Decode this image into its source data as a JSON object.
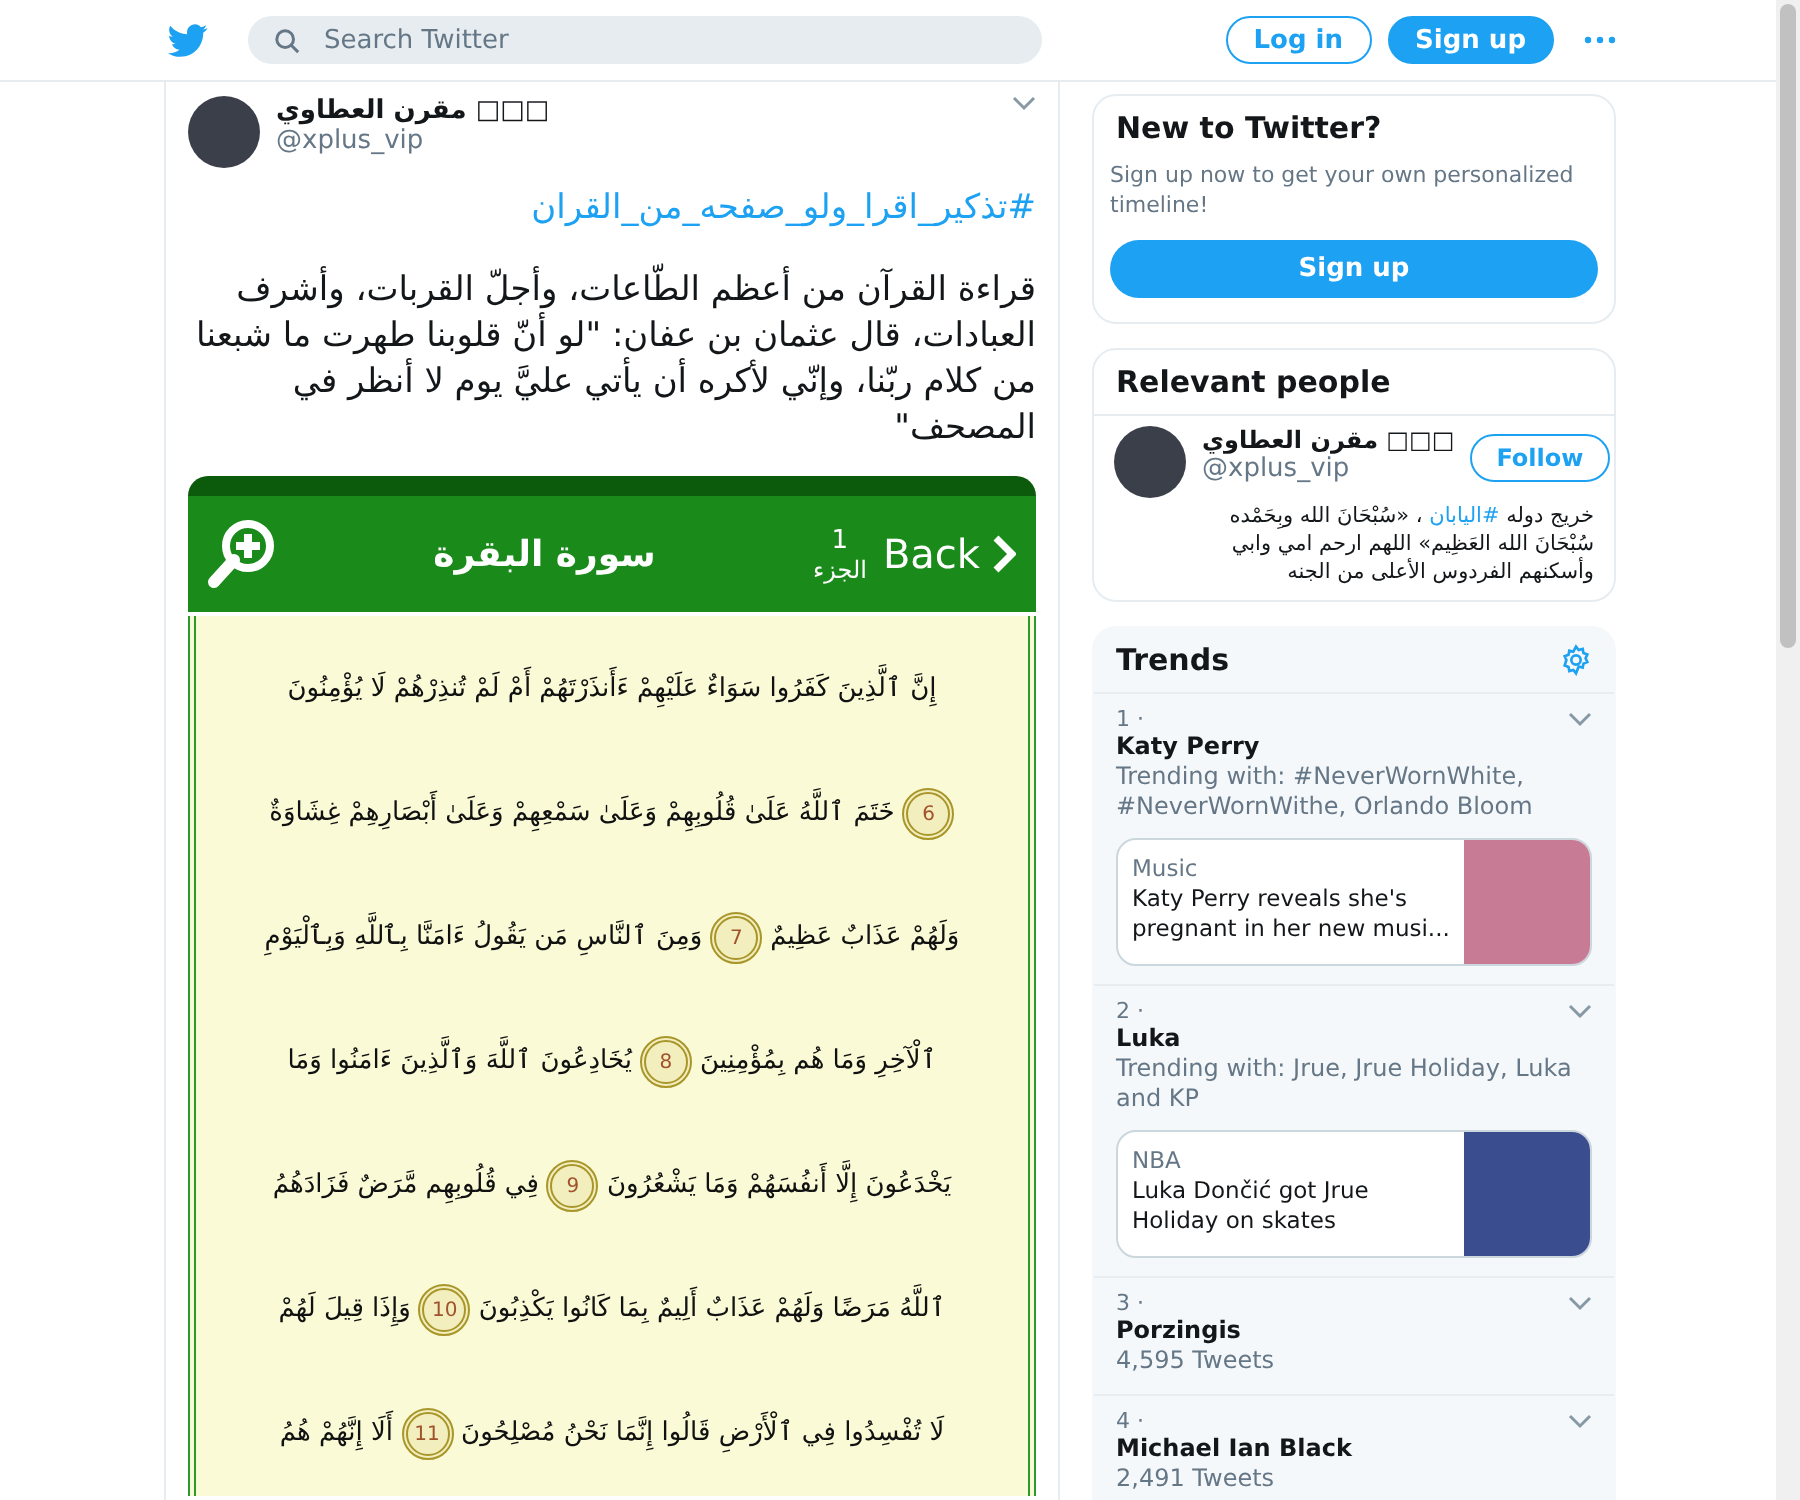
{
  "header": {
    "search": {
      "placeholder": "Search Twitter"
    },
    "login_button": {
      "label": "Log in",
      "kind": "outline"
    },
    "signup_button": {
      "label": "Sign up",
      "kind": "filled"
    }
  },
  "tweet": {
    "author": {
      "name": "مقرن العطاوي □□□",
      "handle": "@xplus_vip"
    },
    "hashtag": "#تذكير_اقرا_ولو_صفحه_من_القران",
    "text": "قراءة القرآن من أعظم الطّاعات، وأجلّ القربات، وأشرف العبادات، قال عثمان بن عفان: \"لو أنّ قلوبنا طهرت ما شبعنا من كلام ربّنا، وإنّي لأكره أن يأتي عليَّ يوم لا أنظر في المصحف\"",
    "attachment": {
      "back": "Back",
      "juz_number": "1",
      "juz_label": "الجزء",
      "surah": "سورة البقرة",
      "lines": [
        [
          {
            "kind": "text",
            "text": "إِنَّ ٱلَّذِينَ كَفَرُوا سَوَاءٌ عَلَيْهِمْ ءَأَنذَرْتَهُمْ أَمْ لَمْ تُنذِرْهُمْ لَا يُؤْمِنُونَ"
          }
        ],
        [
          {
            "kind": "marker",
            "text": "6"
          },
          {
            "kind": "text",
            "text": "خَتَمَ ٱللَّهُ عَلَىٰ قُلُوبِهِمْ وَعَلَىٰ سَمْعِهِمْ وَعَلَىٰ أَبْصَارِهِمْ غِشَاوَةٌ"
          }
        ],
        [
          {
            "kind": "text",
            "text": "وَلَهُمْ عَذَابٌ عَظِيمٌ"
          },
          {
            "kind": "marker",
            "text": "7"
          },
          {
            "kind": "text",
            "text": "وَمِنَ ٱلنَّاسِ مَن يَقُولُ ءَامَنَّا بِٱللَّهِ وَبِٱلْيَوْمِ"
          }
        ],
        [
          {
            "kind": "text",
            "text": "ٱلْآخِرِ وَمَا هُم بِمُؤْمِنِينَ"
          },
          {
            "kind": "marker",
            "text": "8"
          },
          {
            "kind": "text",
            "text": "يُخَادِعُونَ ٱللَّهَ وَٱلَّذِينَ ءَامَنُوا وَمَا"
          }
        ],
        [
          {
            "kind": "text",
            "text": "يَخْدَعُونَ إِلَّا أَنفُسَهُمْ وَمَا يَشْعُرُونَ"
          },
          {
            "kind": "marker",
            "text": "9"
          },
          {
            "kind": "text",
            "text": "فِي قُلُوبِهِم مَّرَضٌ فَزَادَهُمُ"
          }
        ],
        [
          {
            "kind": "text",
            "text": "ٱللَّهُ مَرَضًا وَلَهُمْ عَذَابٌ أَلِيمٌ بِمَا كَانُوا يَكْذِبُونَ"
          },
          {
            "kind": "marker",
            "text": "10"
          },
          {
            "kind": "text",
            "text": "وَإِذَا قِيلَ لَهُمْ"
          }
        ],
        [
          {
            "kind": "text",
            "text": "لَا تُفْسِدُوا فِي ٱلْأَرْضِ قَالُوا إِنَّمَا نَحْنُ مُصْلِحُونَ"
          },
          {
            "kind": "marker",
            "text": "11"
          },
          {
            "kind": "text",
            "text": "أَلَا إِنَّهُمْ هُمُ"
          }
        ]
      ]
    }
  },
  "sidebar": {
    "signup_card": {
      "title": "New to Twitter?",
      "text": "Sign up now to get your own personalized timeline!",
      "button": "Sign up"
    },
    "relevant_people": {
      "title": "Relevant people",
      "person": {
        "name": "مقرن العطاوي □□□",
        "handle": "@xplus_vip",
        "follow": "Follow",
        "bio": [
          {
            "kind": "text",
            "text": "خريج دوله "
          },
          {
            "kind": "hashtag",
            "text": "#اليابان"
          },
          {
            "kind": "text",
            "text": " ، «سُبْحَانَ الله وبِحَمْده سُبْحَانَ الله العَظِيم» اللهم ارحم امي وابي وأسكنهم الفردوس الأعلى من الجنه"
          }
        ]
      }
    },
    "trends": {
      "title": "Trends",
      "items": [
        {
          "rank": "1 ·",
          "name": "Katy Perry",
          "meta": "Trending with: #NeverWornWhite, #NeverWornWithe, Orlando Bloom",
          "card": {
            "category": "Music",
            "headline": "Katy Perry reveals she's pregnant in her new musi..."
          }
        },
        {
          "rank": "2 ·",
          "name": "Luka",
          "meta": "Trending with: Jrue, Jrue Holiday, Luka and KP",
          "card": {
            "category": "NBA",
            "headline": "Luka Dončić got Jrue Holiday on skates"
          }
        },
        {
          "rank": "3 ·",
          "name": "Porzingis",
          "meta": "4,595 Tweets"
        },
        {
          "rank": "4 ·",
          "name": "Michael Ian Black",
          "meta": "2,491 Tweets"
        }
      ]
    }
  }
}
